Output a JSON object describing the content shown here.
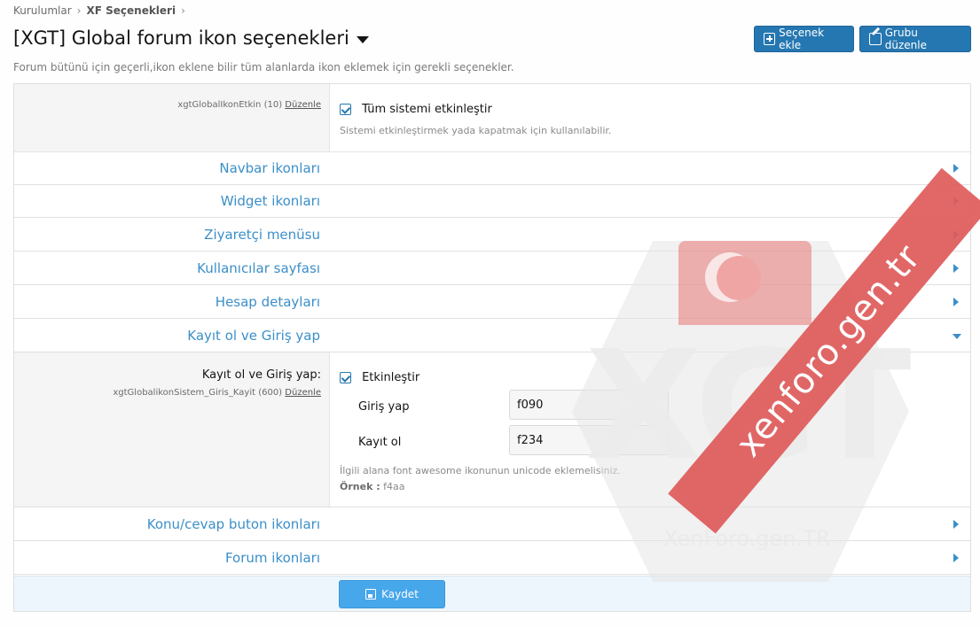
{
  "breadcrumb": {
    "item1": "Kurulumlar",
    "item2": "XF Seçenekleri"
  },
  "page": {
    "title": "[XGT] Global forum ikon seçenekleri",
    "description": "Forum bütünü için geçerli,ikon eklene bilir tüm alanlarda ikon eklemek için gerekli seçenekler."
  },
  "actions": {
    "add_option": "Seçenek ekle",
    "edit_group": "Grubu düzenle"
  },
  "option_main": {
    "meta": "xgtGlobalIkonEtkin (10)",
    "edit": "Düzenle",
    "checkbox_label": "Tüm sistemi etkinleştir",
    "explain": "Sistemi etkinleştirmek yada kapatmak için kullanılabilir."
  },
  "sections": {
    "s1": "Navbar ikonları",
    "s2": "Widget ikonları",
    "s3": "Ziyaretçi menüsu",
    "s4": "Kullanıcılar sayfası",
    "s5": "Hesap detayları",
    "s6": "Kayıt ol ve Giriş yap",
    "s7": "Konu/cevap buton ikonları",
    "s8": "Forum ikonları"
  },
  "expanded": {
    "label": "Kayıt ol ve Giriş yap:",
    "meta": "xgtGlobalikonSistem_Giris_Kayit (600)",
    "edit": "Düzenle",
    "checkbox_label": "Etkinleştir",
    "login_label": "Giriş yap",
    "login_value": "f090",
    "register_label": "Kayıt ol",
    "register_value": "f234",
    "hint": "İlgili alana font awesome ikonunun unicode eklemelisiniz.",
    "example_label": "Örnek :",
    "example_value": "f4aa"
  },
  "footer": {
    "save": "Kaydet"
  },
  "watermark": {
    "logo": "XGT",
    "small": "XenForo.gen.TR",
    "banner": "xenforo.gen.tr"
  },
  "colors": {
    "accent": "#2577b1",
    "link": "#3b8fc8",
    "banner": "#df5b5b"
  }
}
